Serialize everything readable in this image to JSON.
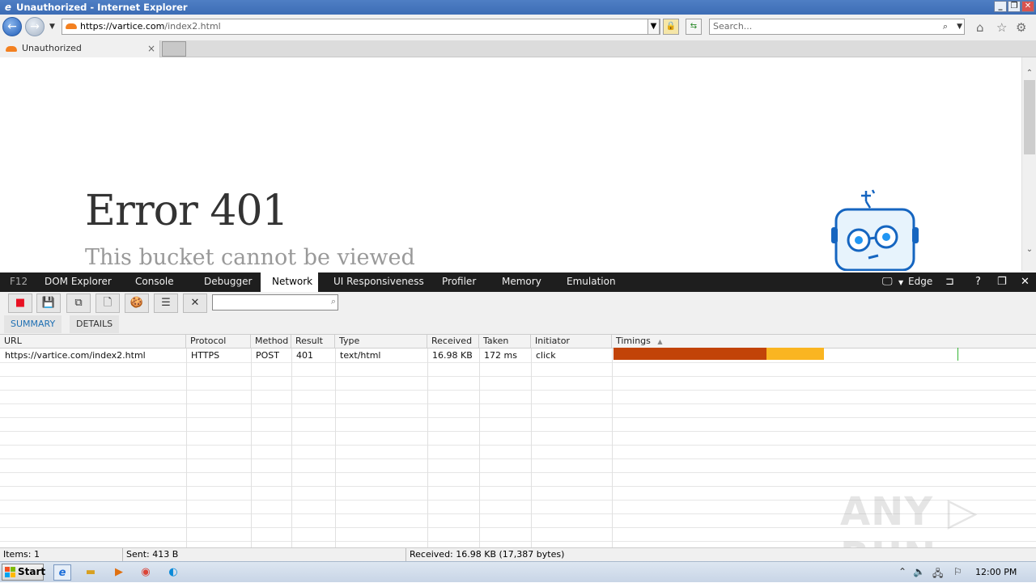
{
  "window": {
    "title": "Unauthorized - Internet Explorer"
  },
  "nav": {
    "url_host": "https://vartice.com",
    "url_path": "/index2.html",
    "search_placeholder": "Search..."
  },
  "tabs": [
    {
      "label": "Unauthorized"
    }
  ],
  "page": {
    "error_title": "Error 401",
    "error_subtitle": "This bucket cannot be viewed"
  },
  "devtools": {
    "tabs": [
      "F12",
      "DOM Explorer",
      "Console",
      "Debugger",
      "Network",
      "UI Responsiveness",
      "Profiler",
      "Memory",
      "Emulation"
    ],
    "active_tab": "Network",
    "mode": "Edge",
    "subtabs": [
      "SUMMARY",
      "DETAILS"
    ],
    "columns": [
      "URL",
      "Protocol",
      "Method",
      "Result",
      "Type",
      "Received",
      "Taken",
      "Initiator",
      "Timings"
    ],
    "rows": [
      {
        "url": "https://vartice.com/index2.html",
        "protocol": "HTTPS",
        "method": "POST",
        "result": "401",
        "type": "text/html",
        "received": "16.98 KB",
        "taken": "172 ms",
        "initiator": "click"
      }
    ],
    "status": {
      "items": "Items: 1",
      "sent": "Sent: 413 B",
      "received": "Received: 16.98 KB (17,387 bytes)"
    }
  },
  "taskbar": {
    "start_label": "Start",
    "clock": "12:00 PM"
  },
  "watermark": "ANY RUN"
}
